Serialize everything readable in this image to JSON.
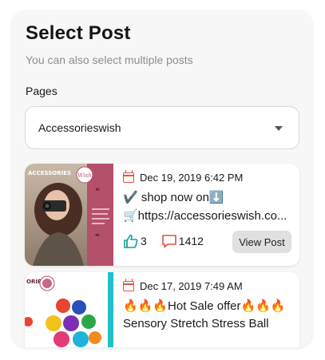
{
  "header": {
    "title": "Select Post",
    "subtitle": "You can also select multiple posts"
  },
  "pages": {
    "label": "Pages",
    "selected": "Accessorieswish"
  },
  "posts": [
    {
      "date": "Dec 19, 2019 6:42 PM",
      "line1": "✔️ shop now on⬇️",
      "line2": "🛒https://accessorieswish.co...",
      "likes": "3",
      "comments": "1412",
      "button": "View Post",
      "thumb_brand": "ACCESSORIES",
      "thumb_script": "Wish"
    },
    {
      "date": "Dec 17, 2019 7:49 AM",
      "line1": "🔥🔥🔥Hot Sale offer🔥🔥🔥",
      "line2": "Sensory Stretch Stress Ball",
      "thumb_brand": "ORIES"
    }
  ],
  "colors": {
    "accent_red": "#e0543d",
    "like_teal": "#1aa29a",
    "comment_red": "#e0543d",
    "pink_panel": "#b5506a",
    "teal_stripe": "#1fc0c9"
  }
}
